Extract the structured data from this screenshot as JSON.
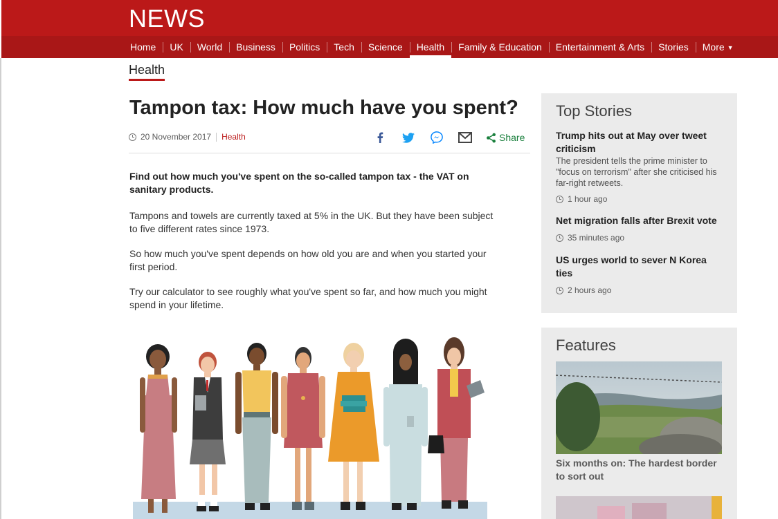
{
  "brand": "NEWS",
  "nav": {
    "items": [
      "Home",
      "UK",
      "World",
      "Business",
      "Politics",
      "Tech",
      "Science",
      "Health",
      "Family & Education",
      "Entertainment & Arts",
      "Stories",
      "More"
    ],
    "active": "Health"
  },
  "section_tab": "Health",
  "article": {
    "headline": "Tampon tax: How much have you spent?",
    "date": "20 November 2017",
    "section": "Health",
    "share_label": "Share",
    "intro": "Find out how much you've spent on the so-called tampon tax - the VAT on sanitary products.",
    "paragraphs": [
      "Tampons and towels are currently taxed at 5% in the UK. But they have been subject to five different rates since 1973.",
      "So how much you've spent depends on how old you are and when you started your first period.",
      "Try our calculator to see roughly what you've spent so far, and how much you might spend in your lifetime."
    ]
  },
  "top_stories": {
    "title": "Top Stories",
    "items": [
      {
        "title": "Trump hits out at May over tweet criticism",
        "summary": "The president tells the prime minister to \"focus on terrorism\" after she criticised his far-right retweets.",
        "time": "1 hour ago"
      },
      {
        "title": "Net migration falls after Brexit vote",
        "summary": "",
        "time": "35 minutes ago"
      },
      {
        "title": "US urges world to sever N Korea ties",
        "summary": "",
        "time": "2 hours ago"
      }
    ]
  },
  "features": {
    "title": "Features",
    "items": [
      {
        "title": "Six months on: The hardest border to sort out"
      }
    ]
  },
  "colors": {
    "brand_red": "#bb1919",
    "nav_red": "#a91717",
    "share_green": "#197f3c",
    "facebook": "#3b5998",
    "twitter": "#1da1f2",
    "messenger": "#0084ff",
    "sidebar_bg": "#ebebeb"
  },
  "icons": [
    "clock-icon",
    "facebook-icon",
    "twitter-icon",
    "messenger-icon",
    "email-icon",
    "share-icon",
    "chevron-down-icon"
  ]
}
